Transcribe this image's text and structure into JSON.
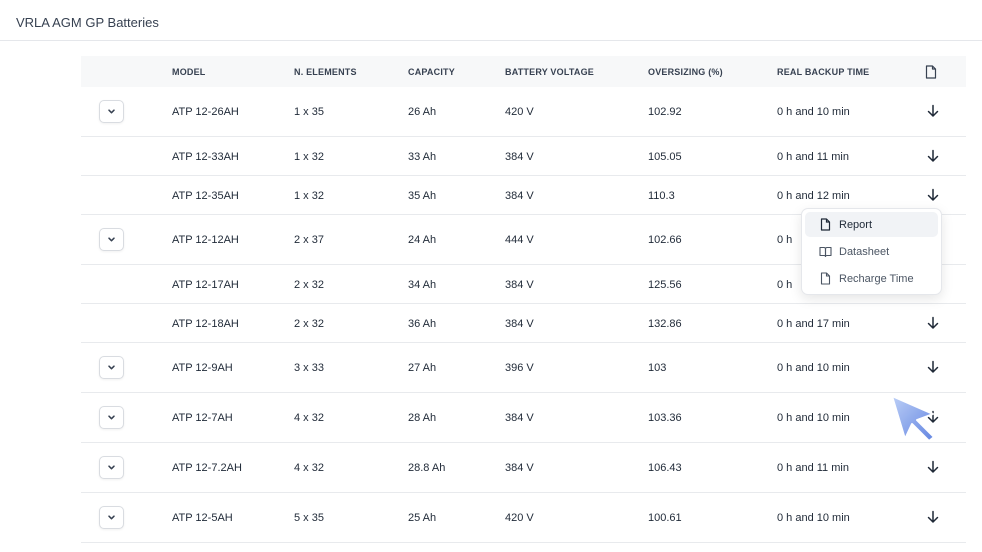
{
  "page": {
    "title": "VRLA AGM GP Batteries"
  },
  "table": {
    "headers": {
      "model": "MODEL",
      "elements": "N. ELEMENTS",
      "capacity": "CAPACITY",
      "voltage": "BATTERY VOLTAGE",
      "oversizing": "OVERSIZING (%)",
      "backup": "REAL BACKUP TIME",
      "report_icon": "document-icon"
    },
    "rows": [
      {
        "model": "ATP 12-26AH",
        "elements": "1 x 35",
        "capacity": "26 Ah",
        "voltage": "420 V",
        "oversizing": "102.92",
        "backup": "0 h and 10 min",
        "expandable": true
      },
      {
        "model": "ATP 12-33AH",
        "elements": "1 x 32",
        "capacity": "33 Ah",
        "voltage": "384 V",
        "oversizing": "105.05",
        "backup": "0 h and 11 min",
        "expandable": false
      },
      {
        "model": "ATP 12-35AH",
        "elements": "1 x 32",
        "capacity": "35 Ah",
        "voltage": "384 V",
        "oversizing": "110.3",
        "backup": "0 h and 12 min",
        "expandable": false
      },
      {
        "model": "ATP 12-12AH",
        "elements": "2 x 37",
        "capacity": "24 Ah",
        "voltage": "444 V",
        "oversizing": "102.66",
        "backup": "0 h",
        "expandable": true
      },
      {
        "model": "ATP 12-17AH",
        "elements": "2 x 32",
        "capacity": "34 Ah",
        "voltage": "384 V",
        "oversizing": "125.56",
        "backup": "0 h",
        "expandable": false
      },
      {
        "model": "ATP 12-18AH",
        "elements": "2 x 32",
        "capacity": "36 Ah",
        "voltage": "384 V",
        "oversizing": "132.86",
        "backup": "0 h and 17 min",
        "expandable": false
      },
      {
        "model": "ATP 12-9AH",
        "elements": "3 x 33",
        "capacity": "27 Ah",
        "voltage": "396 V",
        "oversizing": "103",
        "backup": "0 h and 10 min",
        "expandable": true
      },
      {
        "model": "ATP 12-7AH",
        "elements": "4 x 32",
        "capacity": "28 Ah",
        "voltage": "384 V",
        "oversizing": "103.36",
        "backup": "0 h and 10 min",
        "expandable": true
      },
      {
        "model": "ATP 12-7.2AH",
        "elements": "4 x 32",
        "capacity": "28.8 Ah",
        "voltage": "384 V",
        "oversizing": "106.43",
        "backup": "0 h and 11 min",
        "expandable": true
      },
      {
        "model": "ATP 12-5AH",
        "elements": "5 x 35",
        "capacity": "25 Ah",
        "voltage": "420 V",
        "oversizing": "100.61",
        "backup": "0 h and 10 min",
        "expandable": true
      }
    ]
  },
  "dropdown": {
    "items": [
      {
        "label": "Report",
        "icon": "document-icon",
        "active": true
      },
      {
        "label": "Datasheet",
        "icon": "book-icon",
        "active": false
      },
      {
        "label": "Recharge Time",
        "icon": "document-icon",
        "active": false
      }
    ]
  },
  "colors": {
    "header_bg": "#f7f8f9",
    "border": "#e8eaed",
    "cursor": "#6b8fe8"
  }
}
